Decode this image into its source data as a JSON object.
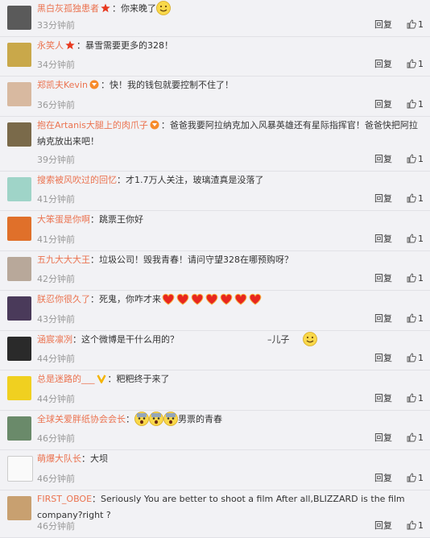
{
  "colors": {
    "username": "#eb7350",
    "text": "#333333",
    "time": "#999999",
    "separator": "#e1e1e6"
  },
  "comments": [
    {
      "user": "黑白灰孤独患者",
      "badge": "star",
      "text": "：你来晚了",
      "emoji": "smile",
      "time": "33分钟前",
      "reply": "回复",
      "likes": "1"
    },
    {
      "user": "永笑人",
      "badge": "star",
      "text": "：暴雪需要更多的328！",
      "time": "34分钟前",
      "reply": "回复",
      "likes": "1"
    },
    {
      "user": "郑凯夫Kevin",
      "badge": "vip",
      "text": "：快！我的钱包就要控制不住了！",
      "time": "36分钟前",
      "reply": "回复",
      "likes": "1"
    },
    {
      "user": "抱在Artanis大腿上的肉爪子",
      "badge": "vip",
      "text": "：爸爸我要阿拉纳克加入风暴英雄还有星际指挥官！爸爸快把阿拉纳克放出来吧！",
      "time": "39分钟前",
      "reply": "回复",
      "likes": "1"
    },
    {
      "user": "搜索被风吹过的回忆",
      "text": "：才1.7万人关注，玻璃渣真是没落了",
      "time": "41分钟前",
      "reply": "回复",
      "likes": "1"
    },
    {
      "user": "大笨蛋是你啊",
      "text": "：跳票王你好",
      "time": "41分钟前",
      "reply": "回复",
      "likes": "1"
    },
    {
      "user": "五九大大大王",
      "text": "：垃圾公司！毁我青春！请问守望328在哪预购呀？",
      "time": "42分钟前",
      "reply": "回复",
      "likes": "1"
    },
    {
      "user": "朕忍你很久了",
      "text": "：死鬼，你咋才来",
      "emoji": "hearts",
      "time": "43分钟前",
      "reply": "回复",
      "likes": "1"
    },
    {
      "user": "涵宸凛冽",
      "text": "：这个微博是干什么用的？",
      "extra": "–儿子",
      "emoji": "smile",
      "time": "44分钟前",
      "reply": "回复",
      "likes": "1"
    },
    {
      "user": "总是迷路的___",
      "badge": "v",
      "text": "：粑粑终于来了",
      "time": "44分钟前",
      "reply": "回复",
      "likes": "1"
    },
    {
      "user": "全球关爱胖纸协会会长",
      "text": "：",
      "emoji": "shock",
      "text2": "男票的青春",
      "time": "46分钟前",
      "reply": "回复",
      "likes": "1"
    },
    {
      "user": "萌爆大队长",
      "text": "：大坝",
      "time": "46分钟前",
      "reply": "回复",
      "likes": "1"
    },
    {
      "user": "FIRST_OBOE",
      "text": "：Seriously You are better to shoot a film After all,BLIZZARD is the film company?right ?",
      "time": "46分钟前",
      "reply": "回复",
      "likes": "1"
    }
  ]
}
